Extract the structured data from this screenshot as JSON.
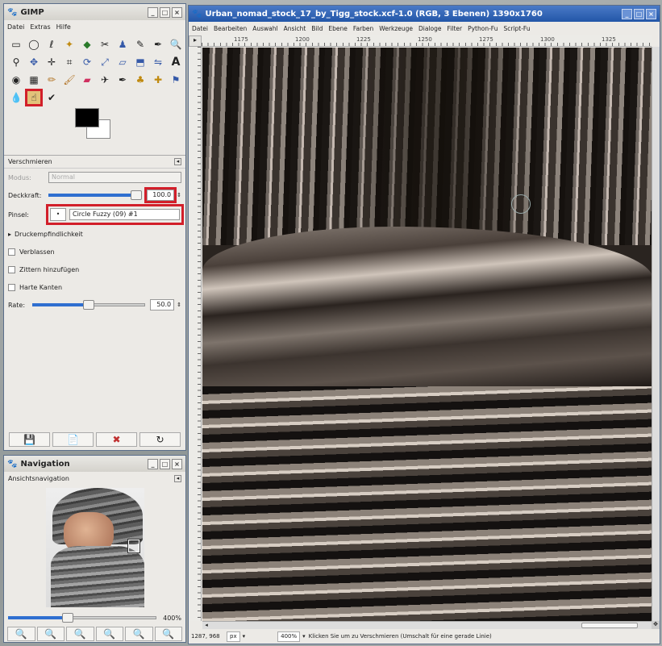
{
  "toolbox": {
    "title": "GIMP",
    "menu": [
      "Datei",
      "Extras",
      "Hilfe"
    ],
    "panel_title": "Verschmieren",
    "mode_label": "Modus:",
    "mode_value": "Normal",
    "opacity_label": "Deckkraft:",
    "opacity_value": "100.0",
    "opacity_fraction": 1.0,
    "brush_label": "Pinsel:",
    "brush_value": "Circle Fuzzy (09) #1",
    "pressure_label": "Druckempfindlichkeit",
    "fade_label": "Verblassen",
    "jitter_label": "Zittern hinzufügen",
    "hard_edges_label": "Harte Kanten",
    "rate_label": "Rate:",
    "rate_value": "50.0",
    "rate_fraction": 0.5
  },
  "navigation": {
    "title": "Navigation",
    "subtitle": "Ansichtsnavigation",
    "zoom_value": "400%",
    "zoom_fraction": 0.4
  },
  "image_window": {
    "title": "Urban_nomad_stock_17_by_Tigg_stock.xcf-1.0 (RGB, 3 Ebenen) 1390x1760",
    "menu": [
      "Datei",
      "Bearbeiten",
      "Auswahl",
      "Ansicht",
      "Bild",
      "Ebene",
      "Farben",
      "Werkzeuge",
      "Dialoge",
      "Filter",
      "Python-Fu",
      "Script-Fu"
    ],
    "ruler_ticks": [
      "1175",
      "1200",
      "1225",
      "1250",
      "1275",
      "1300",
      "1325"
    ],
    "coords": "1287, 968",
    "unit": "px",
    "zoom": "400%",
    "status_message": "Klicken Sie um zu Verschmieren (Umschalt für eine gerade Linie)"
  }
}
